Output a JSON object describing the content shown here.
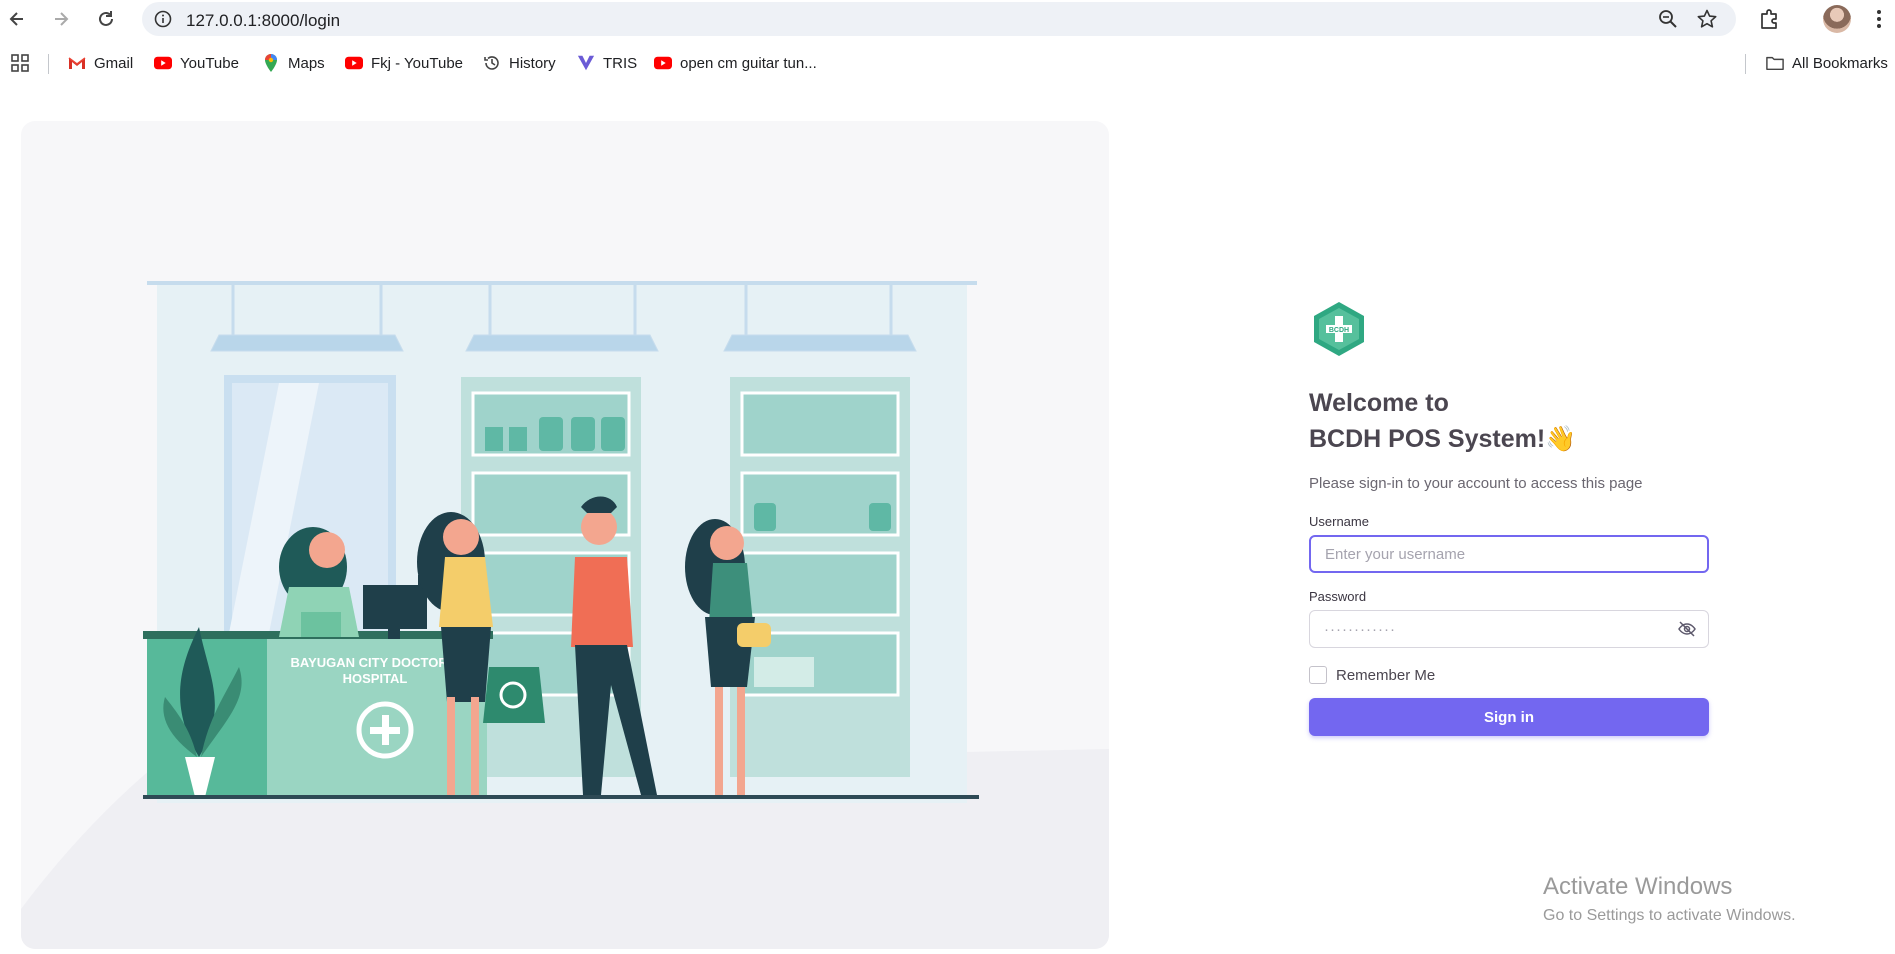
{
  "browser": {
    "url": "127.0.0.1:8000/login",
    "bookmarks": [
      {
        "label": "Gmail",
        "icon": "gmail-icon"
      },
      {
        "label": "YouTube",
        "icon": "youtube-icon"
      },
      {
        "label": "Maps",
        "icon": "maps-icon"
      },
      {
        "label": "Fkj - YouTube",
        "icon": "youtube-icon"
      },
      {
        "label": "History",
        "icon": "history-icon"
      },
      {
        "label": "TRIS",
        "icon": "tris-icon"
      },
      {
        "label": "open cm guitar tun...",
        "icon": "youtube-icon"
      }
    ],
    "all_bookmarks": "All Bookmarks"
  },
  "illustration": {
    "counter_text": "BAYUGAN CITY DOCTOR'S HOSPITAL"
  },
  "login": {
    "logo_text": "BCDH",
    "welcome_line1": "Welcome to",
    "welcome_line2": "BCDH POS System!",
    "wave_emoji": "👋",
    "subtitle": "Please sign-in to your account to access this page",
    "username_label": "Username",
    "username_placeholder": "Enter your username",
    "password_label": "Password",
    "password_mask": "············",
    "remember_label": "Remember Me",
    "signin_label": "Sign in"
  },
  "watermark": {
    "title": "Activate Windows",
    "subtitle": "Go to Settings to activate Windows."
  },
  "colors": {
    "primary": "#7367f0",
    "brand_green": "#2fa882"
  }
}
